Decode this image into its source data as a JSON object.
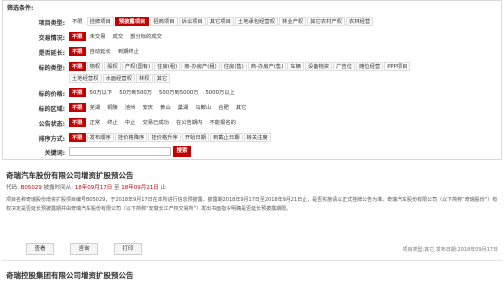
{
  "panel": {
    "title": "筛选条件:"
  },
  "filters": [
    {
      "label": "项目类型:",
      "options": [
        {
          "text": "不限",
          "state": "plain"
        },
        {
          "text": "挂牌项目",
          "state": "normal"
        },
        {
          "text": "预披露项目",
          "state": "active-tag"
        },
        {
          "text": "招商项目",
          "state": "normal"
        },
        {
          "text": "诉讼项目",
          "state": "normal"
        },
        {
          "text": "其它项目",
          "state": "normal"
        },
        {
          "text": "土地承包经营权",
          "state": "normal"
        },
        {
          "text": "林业产权",
          "state": "normal"
        },
        {
          "text": "其它农村产权",
          "state": "normal"
        },
        {
          "text": "农林经营",
          "state": "normal"
        }
      ]
    },
    {
      "label": "交易情况:",
      "options": [
        {
          "text": "不限",
          "state": "active"
        },
        {
          "text": "未交易",
          "state": "plain"
        },
        {
          "text": "成交",
          "state": "plain"
        },
        {
          "text": "部分标的成交",
          "state": "plain"
        }
      ]
    },
    {
      "label": "是否延长:",
      "options": [
        {
          "text": "不限",
          "state": "active"
        },
        {
          "text": "自动延长",
          "state": "plain"
        },
        {
          "text": "到期终止",
          "state": "plain"
        }
      ]
    },
    {
      "label": "标的类型:",
      "options": [
        {
          "text": "不限",
          "state": "active"
        },
        {
          "text": "物权",
          "state": "normal"
        },
        {
          "text": "股权",
          "state": "normal"
        },
        {
          "text": "产权(国有)",
          "state": "normal"
        },
        {
          "text": "住房(租)",
          "state": "normal"
        },
        {
          "text": "商-办房产(租)",
          "state": "normal"
        },
        {
          "text": "住房(售)",
          "state": "normal"
        },
        {
          "text": "商-办房产(售)",
          "state": "normal"
        },
        {
          "text": "车辆",
          "state": "normal"
        },
        {
          "text": "设备物资",
          "state": "normal"
        },
        {
          "text": "广告位",
          "state": "normal"
        },
        {
          "text": "摊位经营",
          "state": "normal"
        },
        {
          "text": "PPP项目",
          "state": "normal"
        }
      ]
    },
    {
      "label": "",
      "options": [
        {
          "text": "土地经营权",
          "state": "normal"
        },
        {
          "text": "水面经营权",
          "state": "normal"
        },
        {
          "text": "林权",
          "state": "normal"
        },
        {
          "text": "其它",
          "state": "normal"
        }
      ]
    },
    {
      "label": "标的价格:",
      "options": [
        {
          "text": "不限",
          "state": "active"
        },
        {
          "text": "50万以下",
          "state": "plain"
        },
        {
          "text": "50万到500万",
          "state": "plain"
        },
        {
          "text": "500万到5000万",
          "state": "plain"
        },
        {
          "text": "5000万以上",
          "state": "plain"
        }
      ]
    },
    {
      "label": "标的区域:",
      "options": [
        {
          "text": "不限",
          "state": "active"
        },
        {
          "text": "芜湖",
          "state": "plain"
        },
        {
          "text": "铜陵",
          "state": "plain"
        },
        {
          "text": "池州",
          "state": "plain"
        },
        {
          "text": "安庆",
          "state": "plain"
        },
        {
          "text": "黄山",
          "state": "plain"
        },
        {
          "text": "巢湖",
          "state": "plain"
        },
        {
          "text": "马鞍山",
          "state": "plain"
        },
        {
          "text": "合肥",
          "state": "plain"
        },
        {
          "text": "其它",
          "state": "plain"
        }
      ]
    },
    {
      "label": "公告状态:",
      "options": [
        {
          "text": "不限",
          "state": "active"
        },
        {
          "text": "正常",
          "state": "plain"
        },
        {
          "text": "终止",
          "state": "plain"
        },
        {
          "text": "中止",
          "state": "plain"
        },
        {
          "text": "交易已成功",
          "state": "plain"
        },
        {
          "text": "在公告期内",
          "state": "plain"
        },
        {
          "text": "不能报名的",
          "state": "plain"
        }
      ]
    },
    {
      "label": "排序方式:",
      "options": [
        {
          "text": "不限",
          "state": "active"
        },
        {
          "text": "发布顺序",
          "state": "normal"
        },
        {
          "text": "挂价格降序",
          "state": "normal"
        },
        {
          "text": "挂价格升序",
          "state": "normal"
        },
        {
          "text": "开始日期",
          "state": "normal"
        },
        {
          "text": "到截止日期",
          "state": "normal"
        },
        {
          "text": "转关注度",
          "state": "normal"
        }
      ]
    }
  ],
  "keyword": {
    "label": "关键词:",
    "value": "",
    "button": "搜索"
  },
  "result": {
    "title": "奇瑞汽车股份有限公司增资扩股预公告",
    "code_label": "代码:",
    "code": "B05029",
    "period_label": "披露时间从:",
    "start_date": "18年09月17日",
    "to_label": "至",
    "end_date": "18年09月21日",
    "period_suffix": "止",
    "description": "项目名称奇瑞股份增资扩股项目编号B05029，于2018年9月17日在本所进行信息预披露，披露期2018年9月17日至2018年9月21日止，是否实施请以正式挂牌公告为准。奇瑞汽车股份有限公司（以下简称“奇瑞股份”）有权决定是否延长预披露期并由奇瑞汽车股份有限公司（以下简称“安徽长江产权交易所”）发出书面指令明确是否延长预披露期限。",
    "buttons": [
      "查看",
      "咨询",
      "打印"
    ],
    "right_meta": "项目类型:其它 发布日期:2018年09月17日"
  },
  "next_result": {
    "title": "奇瑞控股集团有限公司增资扩股预公告"
  }
}
